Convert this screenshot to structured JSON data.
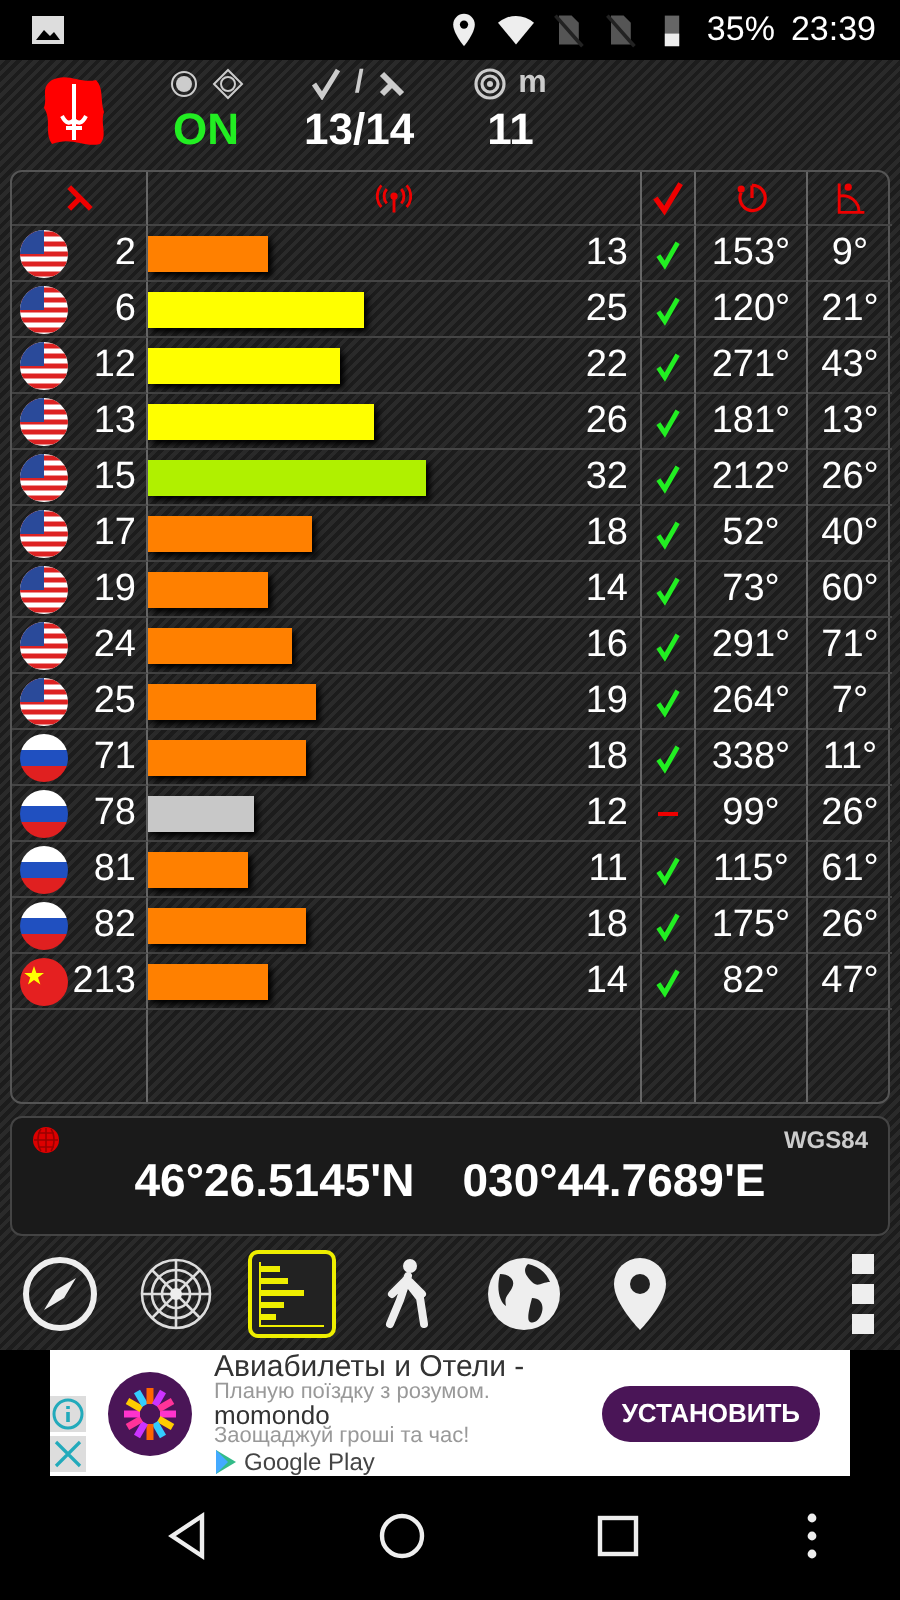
{
  "status_bar": {
    "battery": "35%",
    "time": "23:39"
  },
  "header": {
    "fix_state": "ON",
    "fix_on": true,
    "sats": "13",
    "sats_sep": "/",
    "sats_total": "14",
    "accuracy_unit": "m",
    "accuracy": "11"
  },
  "satellites": [
    {
      "kind": "us",
      "id": "2",
      "level": 0.25,
      "color": "#ff8000",
      "snr": "13",
      "used": true,
      "azimuth": "153°",
      "elevation": "9°"
    },
    {
      "kind": "us",
      "id": "6",
      "level": 0.45,
      "color": "#ffff00",
      "snr": "25",
      "used": true,
      "azimuth": "120°",
      "elevation": "21°"
    },
    {
      "kind": "us",
      "id": "12",
      "level": 0.4,
      "color": "#ffff00",
      "snr": "22",
      "used": true,
      "azimuth": "271°",
      "elevation": "43°"
    },
    {
      "kind": "us",
      "id": "13",
      "level": 0.47,
      "color": "#ffff00",
      "snr": "26",
      "used": true,
      "azimuth": "181°",
      "elevation": "13°"
    },
    {
      "kind": "us",
      "id": "15",
      "level": 0.58,
      "color": "#b0f000",
      "snr": "32",
      "used": true,
      "azimuth": "212°",
      "elevation": "26°"
    },
    {
      "kind": "us",
      "id": "17",
      "level": 0.34,
      "color": "#ff8000",
      "snr": "18",
      "used": true,
      "azimuth": "52°",
      "elevation": "40°"
    },
    {
      "kind": "us",
      "id": "19",
      "level": 0.25,
      "color": "#ff8000",
      "snr": "14",
      "used": true,
      "azimuth": "73°",
      "elevation": "60°"
    },
    {
      "kind": "us",
      "id": "24",
      "level": 0.3,
      "color": "#ff8000",
      "snr": "16",
      "used": true,
      "azimuth": "291°",
      "elevation": "71°"
    },
    {
      "kind": "us",
      "id": "25",
      "level": 0.35,
      "color": "#ff8000",
      "snr": "19",
      "used": true,
      "azimuth": "264°",
      "elevation": "7°"
    },
    {
      "kind": "ru",
      "id": "71",
      "level": 0.33,
      "color": "#ff8000",
      "snr": "18",
      "used": true,
      "azimuth": "338°",
      "elevation": "11°"
    },
    {
      "kind": "ru",
      "id": "78",
      "level": 0.22,
      "color": "#c8c8c8",
      "snr": "12",
      "used": false,
      "azimuth": "99°",
      "elevation": "26°"
    },
    {
      "kind": "ru",
      "id": "81",
      "level": 0.21,
      "color": "#ff8000",
      "snr": "11",
      "used": true,
      "azimuth": "115°",
      "elevation": "61°"
    },
    {
      "kind": "ru",
      "id": "82",
      "level": 0.33,
      "color": "#ff8000",
      "snr": "18",
      "used": true,
      "azimuth": "175°",
      "elevation": "26°"
    },
    {
      "kind": "cn",
      "id": "213",
      "level": 0.25,
      "color": "#ff8000",
      "snr": "14",
      "used": true,
      "azimuth": "82°",
      "elevation": "47°"
    }
  ],
  "coordinates": {
    "datum": "WGS84",
    "latitude": "46°26.5145'N",
    "longitude": "030°44.7689'E"
  },
  "toolbar": [
    {
      "kind": "compass",
      "selected": false
    },
    {
      "kind": "radar",
      "selected": false
    },
    {
      "kind": "bars",
      "selected": true
    },
    {
      "kind": "walk",
      "selected": false
    },
    {
      "kind": "globe",
      "selected": false
    },
    {
      "kind": "pin",
      "selected": false
    }
  ],
  "ad": {
    "title": "Авиабилеты и Отели -",
    "line_1": "Планую поїздку з розумом.",
    "brand": "momondo",
    "line_2": "Заощаджуй гроші та час!",
    "store": "Google Play",
    "button": "УСТАНОВИТЬ"
  }
}
